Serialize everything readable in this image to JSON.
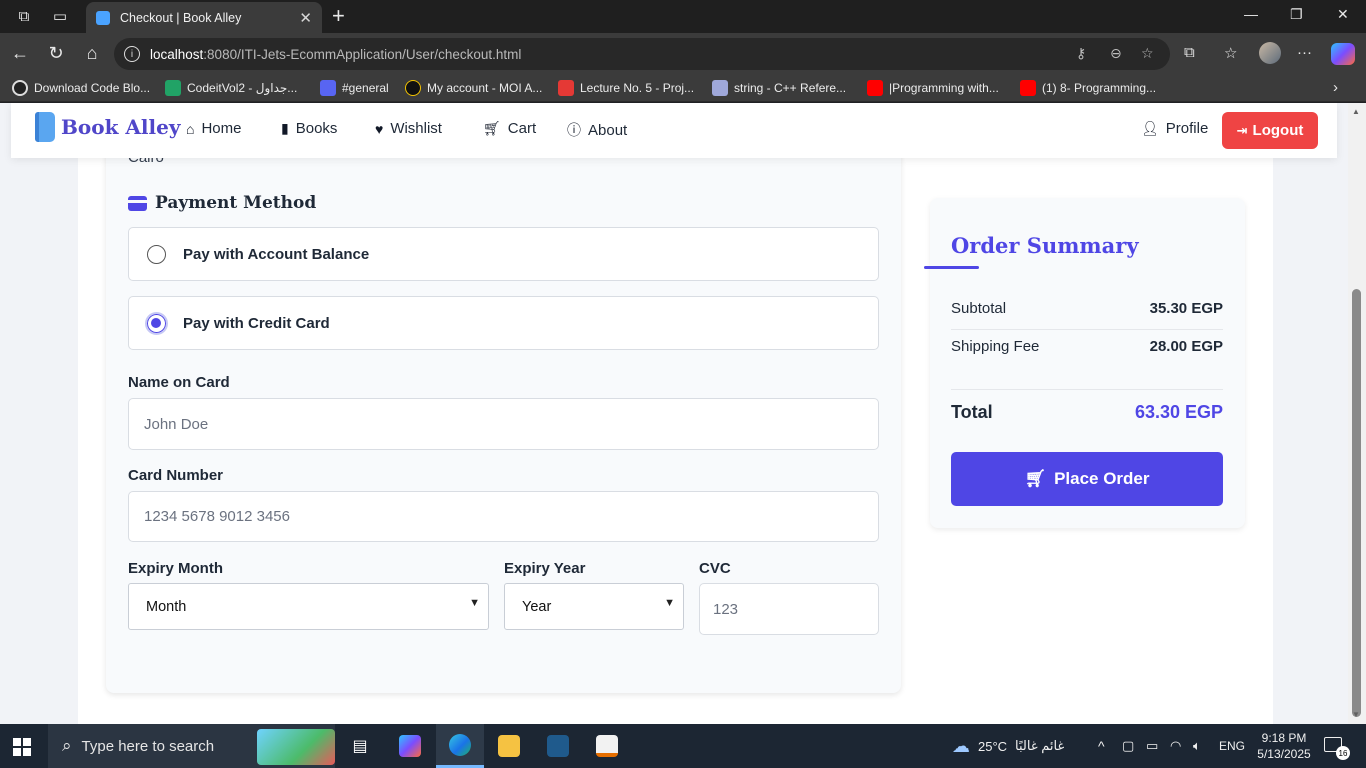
{
  "browser": {
    "tab_title": "Checkout | Book Alley",
    "url_host": "localhost",
    "url_path": ":8080/ITI-Jets-EcommApplication/User/checkout.html",
    "bookmarks": [
      {
        "label": "Download Code Blo...",
        "color": "#222222"
      },
      {
        "label": "CodeitVol2 - جداول...",
        "color": "#21a366"
      },
      {
        "label": "#general",
        "color": "#5865f2"
      },
      {
        "label": "My account - MOI A...",
        "color": "#111111"
      },
      {
        "label": "Lecture No. 5 - Proj...",
        "color": "#e53935"
      },
      {
        "label": "string - C++ Refere...",
        "color": "#9fa8da"
      },
      {
        "label": "|Programming with...",
        "color": "#ff0000"
      },
      {
        "label": "(1) 8- Programming...",
        "color": "#ff0000"
      }
    ]
  },
  "navbar": {
    "brand": "Book Alley",
    "items": [
      {
        "label": "Home",
        "icon": "home-icon"
      },
      {
        "label": "Books",
        "icon": "book-icon"
      },
      {
        "label": "Wishlist",
        "icon": "heart-icon"
      },
      {
        "label": "Cart",
        "icon": "cart-icon"
      },
      {
        "label": "About",
        "icon": "info-icon"
      }
    ],
    "profile": "Profile",
    "logout": "Logout"
  },
  "checkout": {
    "partial_text": "Cairo",
    "payment_title": "Payment Method",
    "options": [
      {
        "label": "Pay with Account Balance",
        "selected": false
      },
      {
        "label": "Pay with Credit Card",
        "selected": true
      }
    ],
    "name_label": "Name on Card",
    "name_placeholder": "John Doe",
    "card_label": "Card Number",
    "card_placeholder": "1234 5678 9012 3456",
    "month_label": "Expiry Month",
    "month_value": "Month",
    "year_label": "Expiry Year",
    "year_value": "Year",
    "cvc_label": "CVC",
    "cvc_placeholder": "123"
  },
  "summary": {
    "title": "Order Summary",
    "subtotal_label": "Subtotal",
    "subtotal_value": "35.30 EGP",
    "shipping_label": "Shipping Fee",
    "shipping_value": "28.00 EGP",
    "total_label": "Total",
    "total_value": "63.30 EGP",
    "button": "Place Order"
  },
  "taskbar": {
    "search_placeholder": "Type here to search",
    "weather": "25°C",
    "weather_text": "غائم غالبًا",
    "lang": "ENG",
    "time": "9:18 PM",
    "date": "5/13/2025",
    "notifications": "16"
  },
  "colors": {
    "accent": "#4f46e5",
    "logout": "#ef4444"
  }
}
